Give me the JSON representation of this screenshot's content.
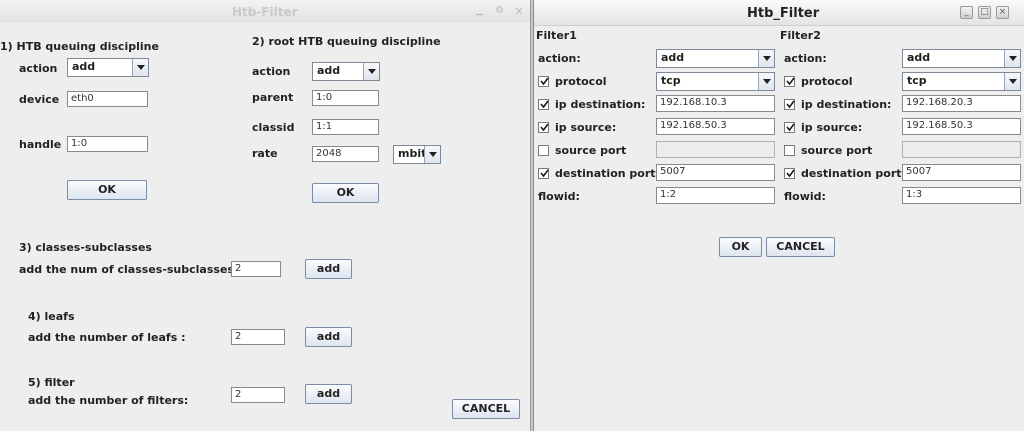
{
  "left": {
    "title": "Htb-Filter",
    "s1": {
      "heading": "1)  HTB queuing discipline",
      "action_label": "action",
      "action_value": "add",
      "device_label": "device",
      "device_value": "eth0",
      "handle_label": "handle",
      "handle_value": "1:0",
      "ok_label": "OK"
    },
    "s2": {
      "heading": "2)  root HTB queuing discipline",
      "action_label": "action",
      "action_value": "add",
      "parent_label": "parent",
      "parent_value": "1:0",
      "classid_label": "classid",
      "classid_value": "1:1",
      "rate_label": "rate",
      "rate_value": "2048",
      "rate_unit": "mbit",
      "ok_label": "OK"
    },
    "s3": {
      "heading": "3) classes-subclasses",
      "prompt": "add the num of classes-subclasses:",
      "value": "2",
      "add_label": "add"
    },
    "s4": {
      "heading": "4)  leafs",
      "prompt": "add the number of leafs :",
      "value": "2",
      "add_label": "add"
    },
    "s5": {
      "heading": "5) filter",
      "prompt": "add the number of filters:",
      "value": "2",
      "add_label": "add"
    },
    "cancel_label": "CANCEL",
    "controls": {
      "close": "×",
      "settings": "⚙",
      "minimize": "▁"
    }
  },
  "right": {
    "title": "Htb_Filter",
    "controls": {
      "minimize": "_",
      "maximize": "□",
      "close": "×"
    },
    "filter1": {
      "header": "Filter1",
      "action_label": "action:",
      "action_value": "add",
      "protocol_label": "protocol",
      "protocol_checked": true,
      "protocol_value": "tcp",
      "ipdst_label": "ip destination:",
      "ipdst_checked": true,
      "ipdst_value": "192.168.10.3",
      "ipsrc_label": "ip source:",
      "ipsrc_checked": true,
      "ipsrc_value": "192.168.50.3",
      "sport_label": "source port",
      "sport_checked": false,
      "sport_value": "",
      "dport_label": "destination port:",
      "dport_checked": true,
      "dport_value": "5007",
      "flowid_label": "flowid:",
      "flowid_value": "1:2"
    },
    "filter2": {
      "header": "Filter2",
      "action_label": "action:",
      "action_value": "add",
      "protocol_label": "protocol",
      "protocol_checked": true,
      "protocol_value": "tcp",
      "ipdst_label": "ip destination:",
      "ipdst_checked": true,
      "ipdst_value": "192.168.20.3",
      "ipsrc_label": "ip source:",
      "ipsrc_checked": true,
      "ipsrc_value": "192.168.50.3",
      "sport_label": "source port",
      "sport_checked": false,
      "sport_value": "",
      "dport_label": "destination port:",
      "dport_checked": true,
      "dport_value": "5007",
      "flowid_label": "flowid:",
      "flowid_value": "1:3"
    },
    "ok_label": "OK",
    "cancel_label": "CANCEL"
  }
}
